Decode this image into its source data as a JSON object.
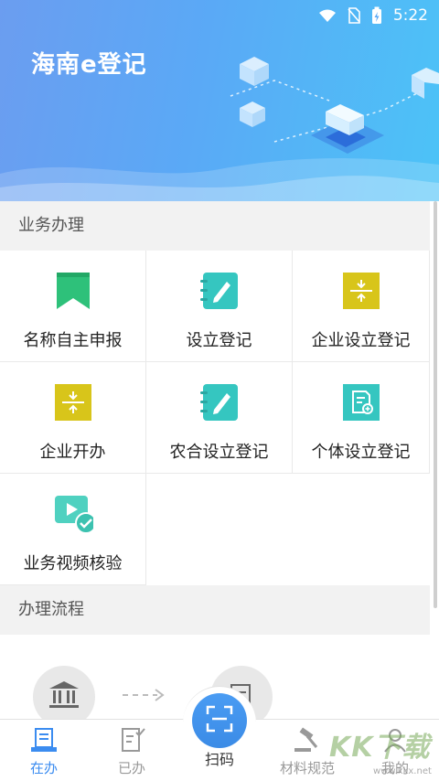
{
  "status_bar": {
    "time": "5:22"
  },
  "header": {
    "title": "海南e登记"
  },
  "business": {
    "section_title": "业务办理",
    "items": [
      {
        "label": "名称自主申报",
        "icon": "bookmark-icon",
        "color": "#2ec17a"
      },
      {
        "label": "设立登记",
        "icon": "notebook-edit-icon",
        "color": "#35c6c0"
      },
      {
        "label": "企业设立登记",
        "icon": "split-icon",
        "color": "#d8c51a"
      },
      {
        "label": "企业开办",
        "icon": "split-icon",
        "color": "#d8c51a"
      },
      {
        "label": "农合设立登记",
        "icon": "notebook-edit-icon",
        "color": "#35c6c0"
      },
      {
        "label": "个体设立登记",
        "icon": "document-add-icon",
        "color": "#35c6c0"
      },
      {
        "label": "业务视频核验",
        "icon": "video-check-icon",
        "color": "#4fd1c0"
      }
    ]
  },
  "process": {
    "section_title": "办理流程"
  },
  "tabbar": {
    "tabs": [
      {
        "label": "在办",
        "icon": "document-stack-icon",
        "active": true
      },
      {
        "label": "已办",
        "icon": "document-check-icon",
        "active": false
      },
      {
        "label": "扫码",
        "icon": "scan-icon",
        "active": false
      },
      {
        "label": "材料规范",
        "icon": "gavel-icon",
        "active": false
      },
      {
        "label": "我的",
        "icon": "person-icon",
        "active": false
      }
    ]
  },
  "watermark": {
    "text": "KK下载",
    "sub": "www.kkx.net"
  },
  "colors": {
    "accent": "#3b8cf0",
    "hero_start": "#6b9df0",
    "hero_end": "#4cc3f7"
  }
}
